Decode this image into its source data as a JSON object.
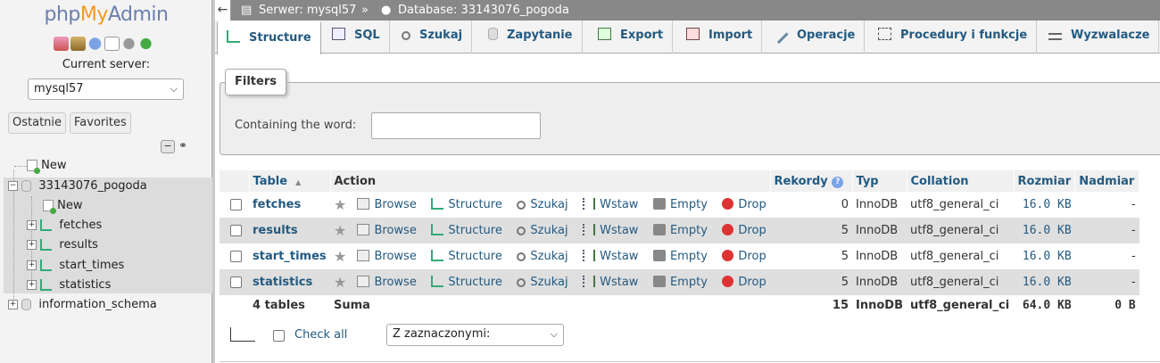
{
  "nav": {
    "logo_php": "php",
    "logo_my": "My",
    "logo_admin": "Admin",
    "current_server_label": "Current server:",
    "server_select": "mysql57",
    "recent_button": "Ostatnie",
    "favorites_button": "Favorites",
    "tree": {
      "new_root": "New",
      "db": "33143076_pogoda",
      "db_new": "New",
      "tables": [
        "fetches",
        "results",
        "start_times",
        "statistics"
      ],
      "other_db": "information_schema"
    }
  },
  "breadcrumb": {
    "back": "←",
    "server": "Serwer: mysql57",
    "sep": "»",
    "database": "Database: 33143076_pogoda"
  },
  "tabs": [
    {
      "label": "Structure",
      "icon": "structure-icon",
      "active": true
    },
    {
      "label": "SQL",
      "icon": "sql-icon"
    },
    {
      "label": "Szukaj",
      "icon": "search-icon"
    },
    {
      "label": "Zapytanie",
      "icon": "query-icon"
    },
    {
      "label": "Export",
      "icon": "export-icon"
    },
    {
      "label": "Import",
      "icon": "import-icon"
    },
    {
      "label": "Operacje",
      "icon": "wrench-icon"
    },
    {
      "label": "Procedury i funkcje",
      "icon": "routines-icon"
    },
    {
      "label": "Wyzwalacze",
      "icon": "triggers-icon"
    }
  ],
  "filters": {
    "legend": "Filters",
    "label": "Containing the word:",
    "value": ""
  },
  "table": {
    "headers": {
      "table": "Table",
      "sort": "▲",
      "action": "Action",
      "rows": "Rekordy",
      "type": "Typ",
      "collation": "Collation",
      "size": "Rozmiar",
      "overhead": "Nadmiar"
    },
    "actions": {
      "browse": "Browse",
      "structure": "Structure",
      "search": "Szukaj",
      "insert": "Wstaw",
      "empty": "Empty",
      "drop": "Drop"
    },
    "rows": [
      {
        "name": "fetches",
        "rows": "0",
        "type": "InnoDB",
        "collation": "utf8_general_ci",
        "size": "16.0 KB",
        "overhead": "-"
      },
      {
        "name": "results",
        "rows": "5",
        "type": "InnoDB",
        "collation": "utf8_general_ci",
        "size": "16.0 KB",
        "overhead": "-"
      },
      {
        "name": "start_times",
        "rows": "5",
        "type": "InnoDB",
        "collation": "utf8_general_ci",
        "size": "16.0 KB",
        "overhead": "-"
      },
      {
        "name": "statistics",
        "rows": "5",
        "type": "InnoDB",
        "collation": "utf8_general_ci",
        "size": "16.0 KB",
        "overhead": "-"
      }
    ],
    "footer": {
      "count": "4 tables",
      "label": "Suma",
      "rows": "15",
      "type": "InnoDB",
      "collation": "utf8_general_ci",
      "size": "64.0 KB",
      "overhead": "0 B"
    }
  },
  "bulk": {
    "check_all": "Check all",
    "with_selected": "Z zaznaczonymi:"
  },
  "colors": {
    "link": "#235a81",
    "logo_blue": "#6c7fb0",
    "logo_orange": "#f29a1e"
  }
}
